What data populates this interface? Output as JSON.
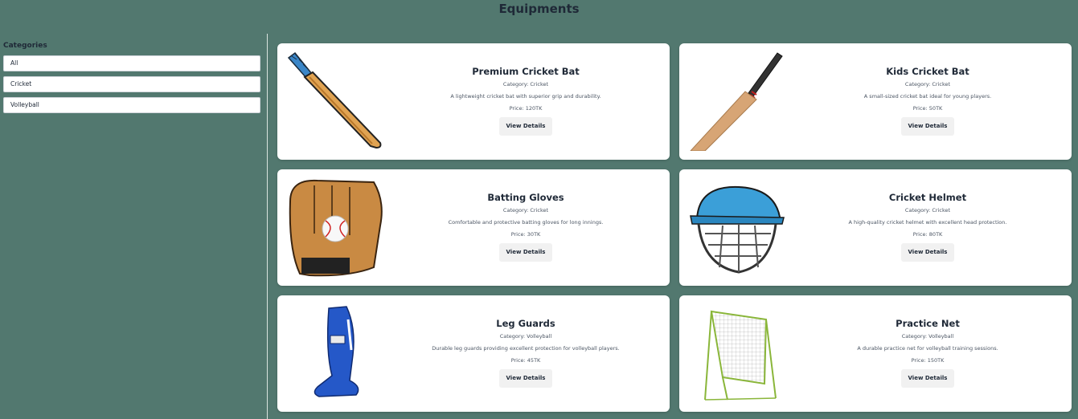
{
  "header": {
    "title": "Equipments"
  },
  "sidebar": {
    "heading": "Categories",
    "items": [
      {
        "label": "All"
      },
      {
        "label": "Cricket"
      },
      {
        "label": "Volleyball"
      }
    ]
  },
  "products": [
    {
      "name": "Premium Cricket Bat",
      "category": "Category: Cricket",
      "description": "A lightweight cricket bat with superior grip and durability.",
      "price": "Price: 120TK",
      "button": "View Details",
      "icon": "cricket-bat-icon"
    },
    {
      "name": "Kids Cricket Bat",
      "category": "Category: Cricket",
      "description": "A small-sized cricket bat ideal for young players.",
      "price": "Price: 50TK",
      "button": "View Details",
      "icon": "cricket-bat-icon"
    },
    {
      "name": "Batting Gloves",
      "category": "Category: Cricket",
      "description": "Comfortable and protective batting gloves for long innings.",
      "price": "Price: 30TK",
      "button": "View Details",
      "icon": "glove-icon"
    },
    {
      "name": "Cricket Helmet",
      "category": "Category: Cricket",
      "description": "A high-quality cricket helmet with excellent head protection.",
      "price": "Price: 80TK",
      "button": "View Details",
      "icon": "helmet-icon"
    },
    {
      "name": "Leg Guards",
      "category": "Category: Volleyball",
      "description": "Durable leg guards providing excellent protection for volleyball players.",
      "price": "Price: 45TK",
      "button": "View Details",
      "icon": "leg-guard-icon"
    },
    {
      "name": "Practice Net",
      "category": "Category: Volleyball",
      "description": "A durable practice net for volleyball training sessions.",
      "price": "Price: 150TK",
      "button": "View Details",
      "icon": "practice-net-icon"
    }
  ]
}
